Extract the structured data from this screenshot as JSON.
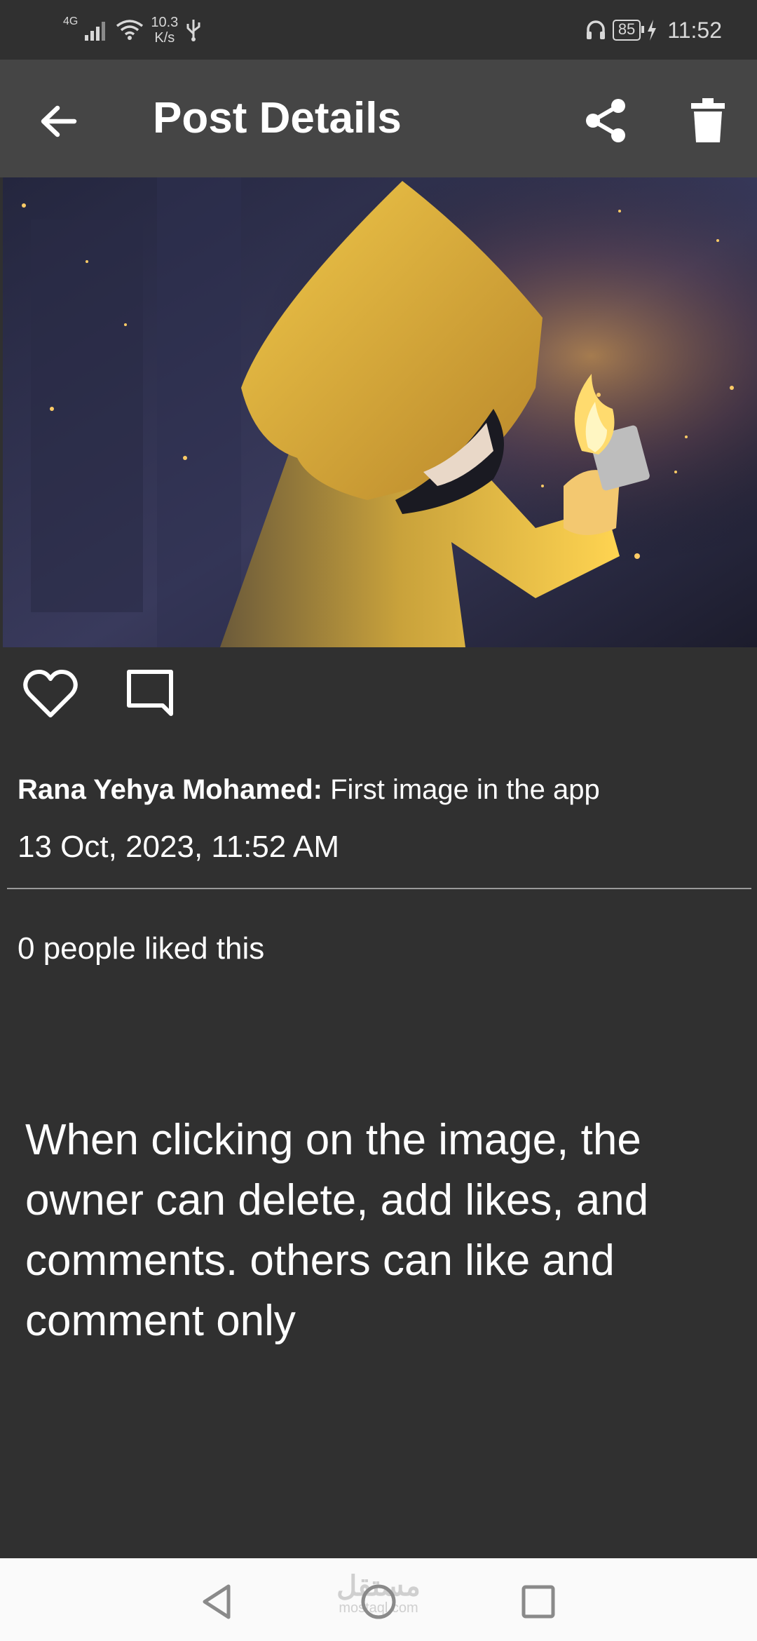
{
  "status_bar": {
    "network_type": "4G",
    "net_speed_value": "10.3",
    "net_speed_unit": "K/s",
    "battery": "85",
    "time": "11:52",
    "icons": [
      "signal-icon",
      "wifi-icon",
      "usb-icon",
      "headphones-icon",
      "battery-icon",
      "charging-icon"
    ]
  },
  "app_bar": {
    "title": "Post Details",
    "icons": [
      "back-arrow-icon",
      "share-icon",
      "trash-icon"
    ]
  },
  "post": {
    "author": "Rana Yehya Mohamed:",
    "caption": "First image in the app",
    "date": "13 Oct, 2023, 11:52 AM",
    "likes_text": "0 people liked this",
    "icons": [
      "heart-icon",
      "comment-icon"
    ]
  },
  "note": "When clicking on the image, the owner can delete, add likes, and comments. others can like and comment only",
  "nav_bar": {
    "icons": [
      "back-triangle-icon",
      "home-circle-icon",
      "recents-square-icon"
    ],
    "watermark_arabic": "مستقل",
    "watermark_latin": "mostaql.com"
  },
  "colors": {
    "background": "#303030",
    "app_bar": "#454545",
    "text": "#ffffff",
    "nav_bar": "#fafafa"
  }
}
